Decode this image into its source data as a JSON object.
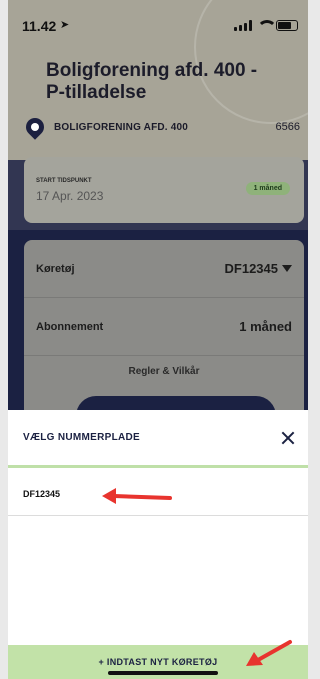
{
  "status": {
    "time": "11.42"
  },
  "header": {
    "title": "Boligforening afd. 400 - P-tilladelse",
    "association": "BOLIGFORENING AFD. 400",
    "association_number": "6566"
  },
  "start": {
    "label": "START TIDSPUNKT",
    "date": "17 Apr. 2023",
    "duration_badge": "1 måned"
  },
  "details": {
    "vehicle_label": "Køretøj",
    "vehicle_value": "DF12345",
    "subscription_label": "Abonnement",
    "subscription_value": "1 måned",
    "terms_link": "Regler & Vilkår"
  },
  "sheet": {
    "title": "VÆLG NUMMERPLADE",
    "plates": [
      "DF12345"
    ],
    "add_button": "+ INDTAST NYT KØRETØJ"
  },
  "colors": {
    "navy": "#1b2142",
    "accent_green": "#c2e2a8",
    "annotation_red": "#e8342e"
  },
  "icons": {
    "location": "location-pin-icon",
    "close": "close-icon",
    "dropdown": "triangle-down-icon"
  }
}
